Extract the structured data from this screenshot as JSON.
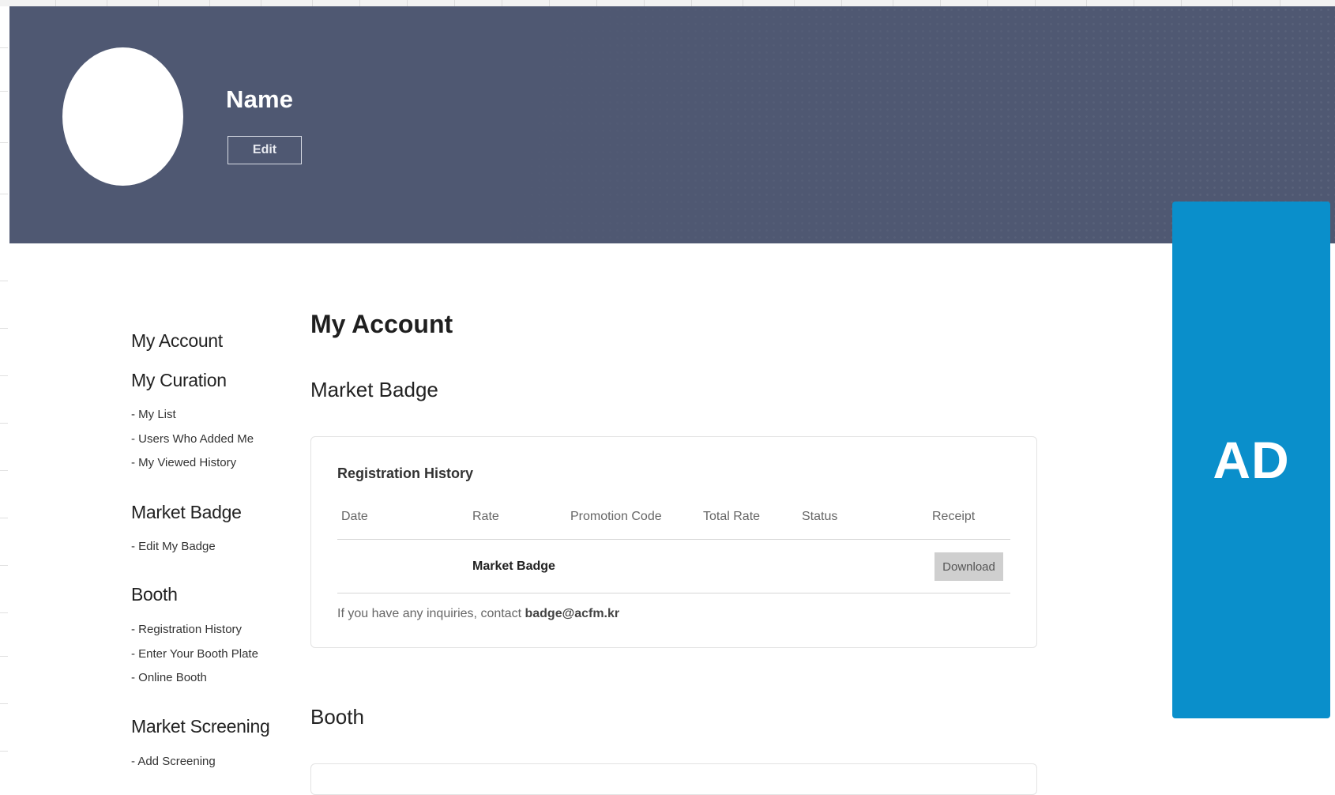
{
  "profile": {
    "name": "Name",
    "edit_label": "Edit"
  },
  "ad": {
    "label": "AD"
  },
  "sidebar": {
    "sections": [
      {
        "heading": "My Account",
        "links": []
      },
      {
        "heading": "My Curation",
        "links": [
          "- My List",
          "- Users Who Added Me",
          "- My Viewed History"
        ]
      },
      {
        "heading": "Market Badge",
        "links": [
          "- Edit My Badge"
        ]
      },
      {
        "heading": "Booth",
        "links": [
          "- Registration History",
          "- Enter Your Booth Plate",
          "- Online Booth"
        ]
      },
      {
        "heading": "Market Screening",
        "links": [
          "- Add Screening"
        ]
      }
    ]
  },
  "main": {
    "title": "My Account",
    "market_badge": {
      "title": "Market Badge",
      "card_title": "Registration History",
      "columns": [
        "Date",
        "Rate",
        "Promotion Code",
        "Total Rate",
        "Status",
        "Receipt"
      ],
      "rows": [
        {
          "date": "",
          "rate": "Market Badge",
          "promotion_code": "",
          "total_rate": "",
          "status": "",
          "receipt_button": "Download"
        }
      ],
      "note_prefix": "If you have any inquiries, contact ",
      "note_email": "badge@acfm.kr"
    },
    "booth": {
      "title": "Booth"
    }
  },
  "colors": {
    "banner": "#4f5872",
    "ad": "#0a8fcb",
    "download_button": "#cfcfcf"
  }
}
